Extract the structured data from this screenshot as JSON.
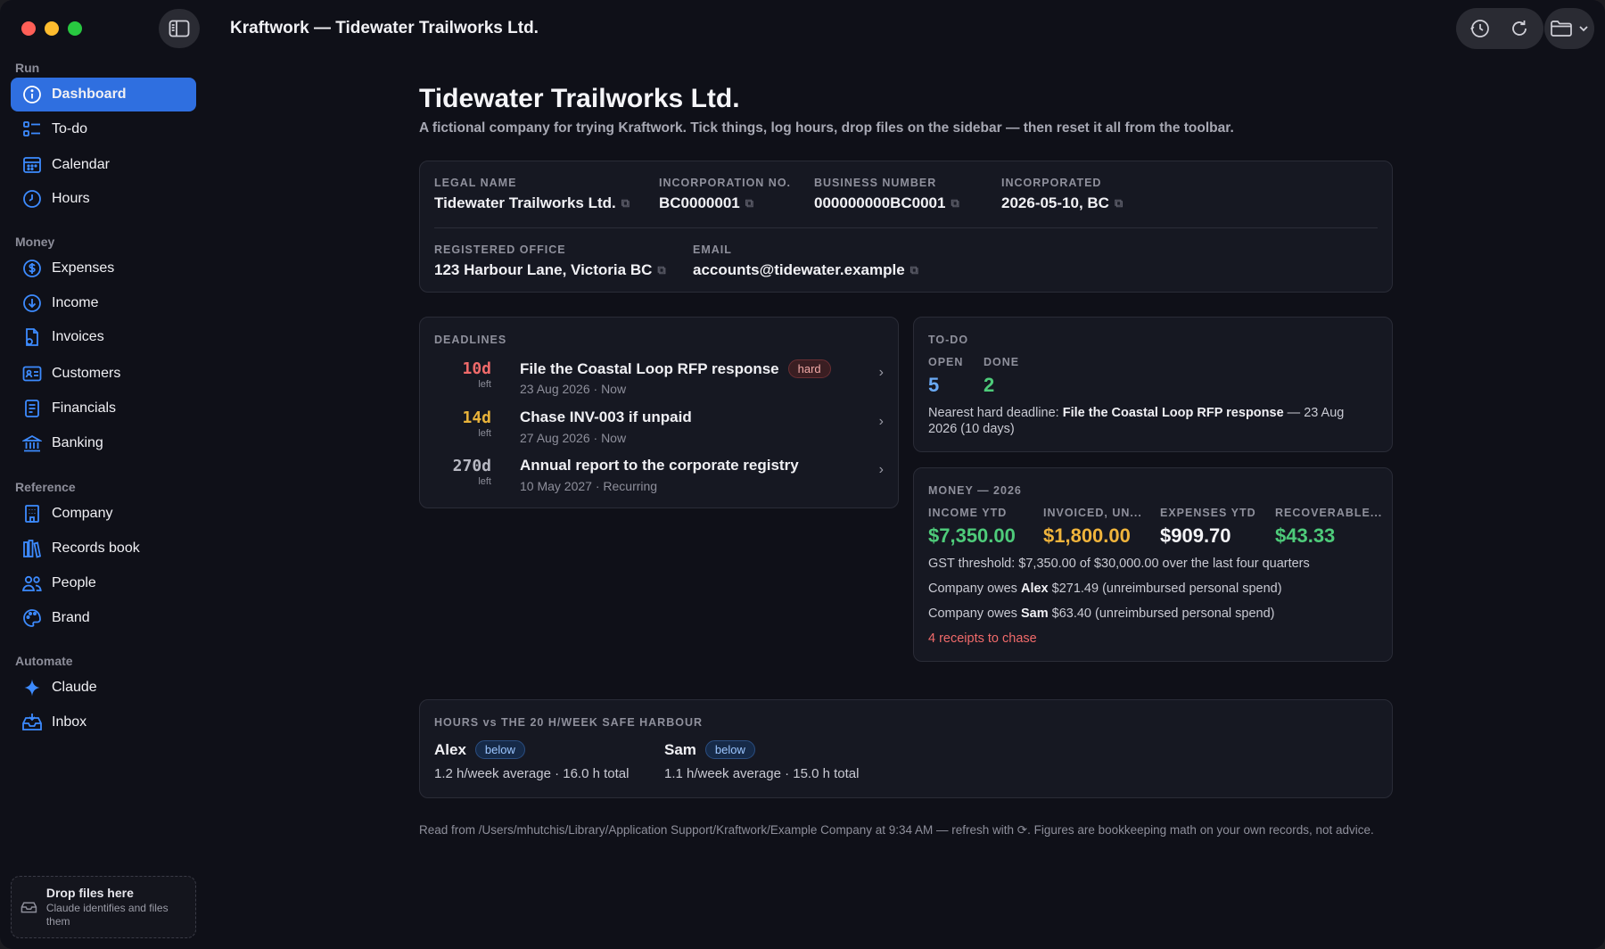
{
  "window": {
    "title": "Kraftwork — Tidewater Trailworks Ltd."
  },
  "sidebar": {
    "sections": {
      "run": "Run",
      "money": "Money",
      "reference": "Reference",
      "automate": "Automate"
    },
    "items": [
      {
        "label": "Dashboard",
        "icon": "info-icon",
        "active": true
      },
      {
        "label": "To-do",
        "icon": "checklist-icon"
      },
      {
        "label": "Calendar",
        "icon": "calendar-icon"
      },
      {
        "label": "Hours",
        "icon": "clock-icon"
      },
      {
        "label": "Expenses",
        "icon": "dollar-icon"
      },
      {
        "label": "Income",
        "icon": "arrow-down-circle-icon"
      },
      {
        "label": "Invoices",
        "icon": "document-icon"
      },
      {
        "label": "Customers",
        "icon": "contact-card-icon"
      },
      {
        "label": "Financials",
        "icon": "ledger-icon"
      },
      {
        "label": "Banking",
        "icon": "bank-icon"
      },
      {
        "label": "Company",
        "icon": "building-icon"
      },
      {
        "label": "Records book",
        "icon": "books-icon"
      },
      {
        "label": "People",
        "icon": "people-icon"
      },
      {
        "label": "Brand",
        "icon": "palette-icon"
      },
      {
        "label": "Claude",
        "icon": "sparkle-icon"
      },
      {
        "label": "Inbox",
        "icon": "inbox-icon"
      }
    ],
    "dropzone": {
      "title": "Drop files here",
      "subtitle": "Claude identifies and files them"
    }
  },
  "header": {
    "title": "Tidewater Trailworks Ltd.",
    "subtitle": "A fictional company for trying Kraftwork. Tick things, log hours, drop files on the sidebar — then reset it all from the toolbar."
  },
  "company_card": {
    "legal_name_label": "LEGAL NAME",
    "legal_name": "Tidewater Trailworks Ltd.",
    "incorporation_label": "INCORPORATION NO.",
    "incorporation_no": "BC0000001",
    "business_number_label": "BUSINESS NUMBER",
    "business_number": "000000000BC0001",
    "incorporated_label": "INCORPORATED",
    "incorporated": "2026-05-10, BC",
    "office_label": "REGISTERED OFFICE",
    "office": "123 Harbour Lane, Victoria BC",
    "email_label": "EMAIL",
    "email": "accounts@tidewater.example"
  },
  "deadlines": {
    "label": "DEADLINES",
    "left_word": "left",
    "items": [
      {
        "days": "10d",
        "color": "#f06a6a",
        "title": "File the Coastal Loop RFP response",
        "badge": "hard",
        "meta": "23 Aug 2026 · Now"
      },
      {
        "days": "14d",
        "color": "#e8b23a",
        "title": "Chase INV-003 if unpaid",
        "badge": "",
        "meta": "27 Aug 2026 · Now"
      },
      {
        "days": "270d",
        "color": "#b7b8c2",
        "title": "Annual report to the corporate registry",
        "badge": "",
        "meta": "10 May 2027 · Recurring"
      }
    ]
  },
  "todo": {
    "label": "TO-DO",
    "open_label": "OPEN",
    "open": "5",
    "done_label": "DONE",
    "done": "2",
    "nearest_prefix": "Nearest hard deadline: ",
    "nearest_title": "File the Coastal Loop RFP response",
    "nearest_suffix": " — 23 Aug 2026 (10 days)"
  },
  "money": {
    "label": "MONEY — 2026",
    "stats": [
      {
        "label": "INCOME YTD",
        "value": "$7,350.00",
        "color": "#4ecb7a"
      },
      {
        "label": "INVOICED, UN...",
        "value": "$1,800.00",
        "color": "#f0b43c"
      },
      {
        "label": "EXPENSES YTD",
        "value": "$909.70",
        "color": "#f3f3f6"
      },
      {
        "label": "RECOVERABLE...",
        "value": "$43.33",
        "color": "#4ecb7a"
      }
    ],
    "gst_line": "GST threshold: $7,350.00 of $30,000.00 over the last four quarters",
    "owes_prefix": "Company owes ",
    "owes_alex_name": "Alex",
    "owes_alex_rest": " $271.49 (unreimbursed personal spend)",
    "owes_sam_name": "Sam",
    "owes_sam_rest": " $63.40 (unreimbursed personal spend)",
    "receipts": "4 receipts to chase",
    "receipts_color": "#f06a6a"
  },
  "hours": {
    "label": "HOURS vs THE 20 H/WEEK SAFE HARBOUR",
    "people": [
      {
        "name": "Alex",
        "badge": "below",
        "summary": "1.2 h/week average · 16.0 h total"
      },
      {
        "name": "Sam",
        "badge": "below",
        "summary": "1.1 h/week average · 15.0 h total"
      }
    ]
  },
  "footer": "Read from /Users/mhutchis/Library/Application Support/Kraftwork/Example Company at 9:34 AM — refresh with ⟳. Figures are bookkeeping math on your own records, not advice."
}
